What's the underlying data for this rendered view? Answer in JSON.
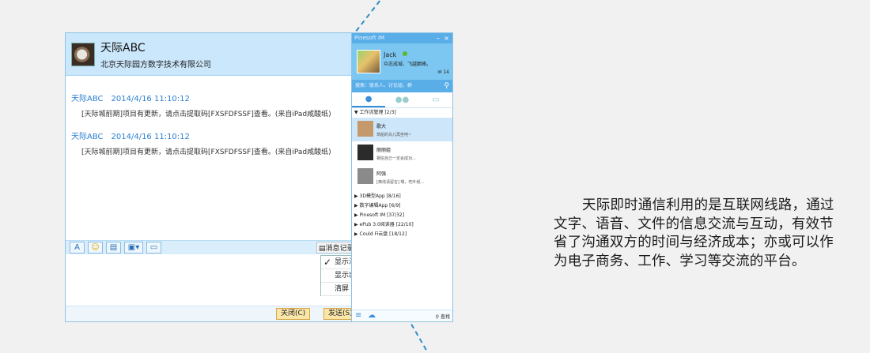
{
  "chat": {
    "contact_name": "天际ABC",
    "organization": "北京天际园方数字技术有限公司",
    "messages": [
      {
        "sender": "天际ABC",
        "time": "2014/4/16 11:10:12",
        "text": "[天际城前期]项目有更新，请点击提取码[FXSFDFSSF]查看。(来自iPad咸酸纸)"
      },
      {
        "sender": "天际ABC",
        "time": "2014/4/16 11:10:12",
        "text": "[天际城前期]项目有更新，请点击提取码[FXSFDFSSF]查看。(来自iPad咸酸纸)"
      }
    ],
    "toolbar": {
      "font_icon": "font-icon",
      "emoji_icon": "emoji-icon",
      "history_label": "消息记录"
    },
    "menu_items": [
      "显示消",
      "显示出",
      "清屏"
    ],
    "close_label": "关闭(C)",
    "send_label": "发送(S)"
  },
  "im": {
    "title": "Pinesoft IM",
    "user_name": "Jack",
    "signature": "众志成城、飞越巅峰。",
    "count": "14",
    "search_placeholder": "搜索：联系人、讨论组、群",
    "group_active": "▼ 工作流管理 [2/3]",
    "contacts": [
      {
        "name": "歌大",
        "sig": "草船的鸟儿再坐吧~",
        "color": "#c49a6c"
      },
      {
        "name": "丽丽姐",
        "sig": "相信自己一定会成功...",
        "color": "#2b2b2b"
      },
      {
        "name": "阿强",
        "sig": "[离线请留言] 嗯，吃叶纸...",
        "color": "#6b6b6b"
      }
    ],
    "groups": [
      "▶ 3D模型App [8/16]",
      "▶ 数字编辑App [6/9]",
      "▶ Pinesoft IM [37/32]",
      "▶ ePub 3.0阅读器 [22/10]",
      "▶ Could Fi云盘 [18/12]"
    ],
    "find_label": "查找"
  },
  "description": "天际即时通信利用的是互联网线路，通过文字、语音、文件的信息交流与互动，有效节省了沟通双方的时间与经济成本；亦或可以作为电子商务、工作、学习等交流的平台。",
  "colors": {
    "accent": "#5aaee8",
    "header": "#cbe7fb",
    "link": "#2a7fcf"
  }
}
